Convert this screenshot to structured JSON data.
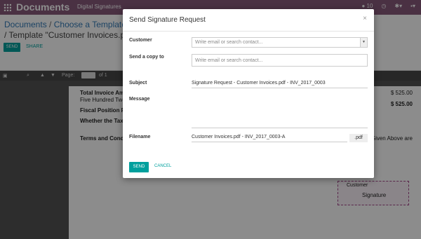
{
  "navbar": {
    "brand": "Documents",
    "menu": "Digital Signatures",
    "badge": "10"
  },
  "breadcrumb": {
    "root": "Documents",
    "step": "Choose a Template",
    "current": "/  Template \"Customer Invoices.pdf - IN"
  },
  "actions": {
    "send": "SEND",
    "share": "SHARE"
  },
  "pdf_toolbar": {
    "page_label": "Page:",
    "page_value": "1",
    "of_label": "of 1"
  },
  "pdf_content": {
    "total_label": "Total Invoice Am",
    "total_words": "Five Hundred Twe",
    "fiscal": "Fiscal Position R",
    "whether": "Whether the Tax",
    "terms": "Terms and Cond",
    "amount1": "$ 525.00",
    "amount2": "$ 525.00",
    "given": "Given Above are",
    "sig_label": "Customer",
    "sig_text": "Signature"
  },
  "modal": {
    "title": "Send Signature Request",
    "customer_label": "Customer",
    "customer_placeholder": "Write email or search contact...",
    "copy_label": "Send a copy to",
    "copy_placeholder": "Write email or search contact...",
    "subject_label": "Subject",
    "subject_value": "Signature Request - Customer Invoices.pdf - INV_2017_0003",
    "message_label": "Message",
    "filename_label": "Filename",
    "filename_value": "Customer Invoices.pdf - INV_2017_0003-A",
    "filename_ext": ".pdf",
    "send": "SEND",
    "cancel": "CANCEL"
  }
}
